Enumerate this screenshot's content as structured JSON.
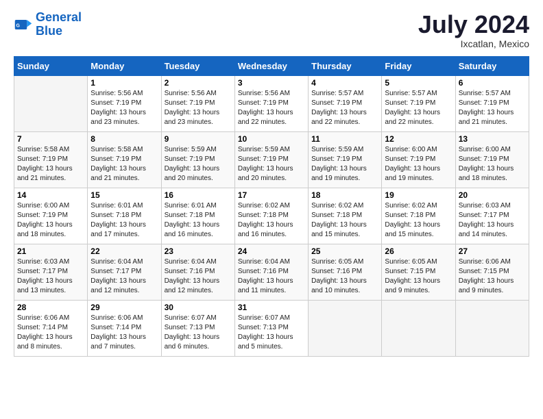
{
  "logo": {
    "line1": "General",
    "line2": "Blue"
  },
  "title": "July 2024",
  "location": "Ixcatlan, Mexico",
  "days_header": [
    "Sunday",
    "Monday",
    "Tuesday",
    "Wednesday",
    "Thursday",
    "Friday",
    "Saturday"
  ],
  "weeks": [
    [
      {
        "num": "",
        "sunrise": "",
        "sunset": "",
        "daylight": ""
      },
      {
        "num": "1",
        "sunrise": "Sunrise: 5:56 AM",
        "sunset": "Sunset: 7:19 PM",
        "daylight": "Daylight: 13 hours and 23 minutes."
      },
      {
        "num": "2",
        "sunrise": "Sunrise: 5:56 AM",
        "sunset": "Sunset: 7:19 PM",
        "daylight": "Daylight: 13 hours and 23 minutes."
      },
      {
        "num": "3",
        "sunrise": "Sunrise: 5:56 AM",
        "sunset": "Sunset: 7:19 PM",
        "daylight": "Daylight: 13 hours and 22 minutes."
      },
      {
        "num": "4",
        "sunrise": "Sunrise: 5:57 AM",
        "sunset": "Sunset: 7:19 PM",
        "daylight": "Daylight: 13 hours and 22 minutes."
      },
      {
        "num": "5",
        "sunrise": "Sunrise: 5:57 AM",
        "sunset": "Sunset: 7:19 PM",
        "daylight": "Daylight: 13 hours and 22 minutes."
      },
      {
        "num": "6",
        "sunrise": "Sunrise: 5:57 AM",
        "sunset": "Sunset: 7:19 PM",
        "daylight": "Daylight: 13 hours and 21 minutes."
      }
    ],
    [
      {
        "num": "7",
        "sunrise": "Sunrise: 5:58 AM",
        "sunset": "Sunset: 7:19 PM",
        "daylight": "Daylight: 13 hours and 21 minutes."
      },
      {
        "num": "8",
        "sunrise": "Sunrise: 5:58 AM",
        "sunset": "Sunset: 7:19 PM",
        "daylight": "Daylight: 13 hours and 21 minutes."
      },
      {
        "num": "9",
        "sunrise": "Sunrise: 5:59 AM",
        "sunset": "Sunset: 7:19 PM",
        "daylight": "Daylight: 13 hours and 20 minutes."
      },
      {
        "num": "10",
        "sunrise": "Sunrise: 5:59 AM",
        "sunset": "Sunset: 7:19 PM",
        "daylight": "Daylight: 13 hours and 20 minutes."
      },
      {
        "num": "11",
        "sunrise": "Sunrise: 5:59 AM",
        "sunset": "Sunset: 7:19 PM",
        "daylight": "Daylight: 13 hours and 19 minutes."
      },
      {
        "num": "12",
        "sunrise": "Sunrise: 6:00 AM",
        "sunset": "Sunset: 7:19 PM",
        "daylight": "Daylight: 13 hours and 19 minutes."
      },
      {
        "num": "13",
        "sunrise": "Sunrise: 6:00 AM",
        "sunset": "Sunset: 7:19 PM",
        "daylight": "Daylight: 13 hours and 18 minutes."
      }
    ],
    [
      {
        "num": "14",
        "sunrise": "Sunrise: 6:00 AM",
        "sunset": "Sunset: 7:19 PM",
        "daylight": "Daylight: 13 hours and 18 minutes."
      },
      {
        "num": "15",
        "sunrise": "Sunrise: 6:01 AM",
        "sunset": "Sunset: 7:18 PM",
        "daylight": "Daylight: 13 hours and 17 minutes."
      },
      {
        "num": "16",
        "sunrise": "Sunrise: 6:01 AM",
        "sunset": "Sunset: 7:18 PM",
        "daylight": "Daylight: 13 hours and 16 minutes."
      },
      {
        "num": "17",
        "sunrise": "Sunrise: 6:02 AM",
        "sunset": "Sunset: 7:18 PM",
        "daylight": "Daylight: 13 hours and 16 minutes."
      },
      {
        "num": "18",
        "sunrise": "Sunrise: 6:02 AM",
        "sunset": "Sunset: 7:18 PM",
        "daylight": "Daylight: 13 hours and 15 minutes."
      },
      {
        "num": "19",
        "sunrise": "Sunrise: 6:02 AM",
        "sunset": "Sunset: 7:18 PM",
        "daylight": "Daylight: 13 hours and 15 minutes."
      },
      {
        "num": "20",
        "sunrise": "Sunrise: 6:03 AM",
        "sunset": "Sunset: 7:17 PM",
        "daylight": "Daylight: 13 hours and 14 minutes."
      }
    ],
    [
      {
        "num": "21",
        "sunrise": "Sunrise: 6:03 AM",
        "sunset": "Sunset: 7:17 PM",
        "daylight": "Daylight: 13 hours and 13 minutes."
      },
      {
        "num": "22",
        "sunrise": "Sunrise: 6:04 AM",
        "sunset": "Sunset: 7:17 PM",
        "daylight": "Daylight: 13 hours and 12 minutes."
      },
      {
        "num": "23",
        "sunrise": "Sunrise: 6:04 AM",
        "sunset": "Sunset: 7:16 PM",
        "daylight": "Daylight: 13 hours and 12 minutes."
      },
      {
        "num": "24",
        "sunrise": "Sunrise: 6:04 AM",
        "sunset": "Sunset: 7:16 PM",
        "daylight": "Daylight: 13 hours and 11 minutes."
      },
      {
        "num": "25",
        "sunrise": "Sunrise: 6:05 AM",
        "sunset": "Sunset: 7:16 PM",
        "daylight": "Daylight: 13 hours and 10 minutes."
      },
      {
        "num": "26",
        "sunrise": "Sunrise: 6:05 AM",
        "sunset": "Sunset: 7:15 PM",
        "daylight": "Daylight: 13 hours and 9 minutes."
      },
      {
        "num": "27",
        "sunrise": "Sunrise: 6:06 AM",
        "sunset": "Sunset: 7:15 PM",
        "daylight": "Daylight: 13 hours and 9 minutes."
      }
    ],
    [
      {
        "num": "28",
        "sunrise": "Sunrise: 6:06 AM",
        "sunset": "Sunset: 7:14 PM",
        "daylight": "Daylight: 13 hours and 8 minutes."
      },
      {
        "num": "29",
        "sunrise": "Sunrise: 6:06 AM",
        "sunset": "Sunset: 7:14 PM",
        "daylight": "Daylight: 13 hours and 7 minutes."
      },
      {
        "num": "30",
        "sunrise": "Sunrise: 6:07 AM",
        "sunset": "Sunset: 7:13 PM",
        "daylight": "Daylight: 13 hours and 6 minutes."
      },
      {
        "num": "31",
        "sunrise": "Sunrise: 6:07 AM",
        "sunset": "Sunset: 7:13 PM",
        "daylight": "Daylight: 13 hours and 5 minutes."
      },
      {
        "num": "",
        "sunrise": "",
        "sunset": "",
        "daylight": ""
      },
      {
        "num": "",
        "sunrise": "",
        "sunset": "",
        "daylight": ""
      },
      {
        "num": "",
        "sunrise": "",
        "sunset": "",
        "daylight": ""
      }
    ]
  ]
}
